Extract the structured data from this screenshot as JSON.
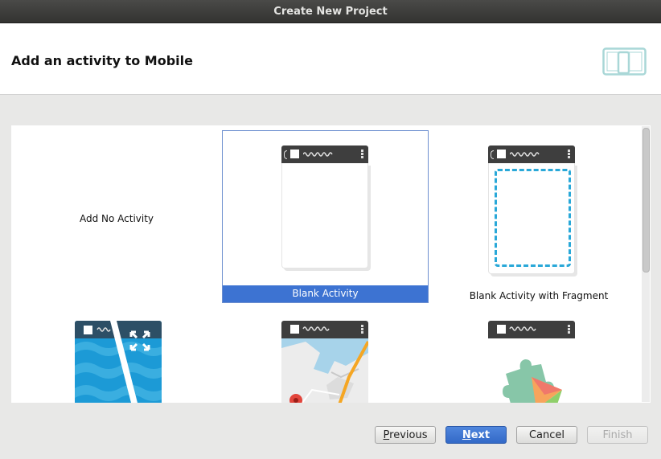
{
  "window": {
    "title": "Create New Project"
  },
  "header": {
    "heading": "Add an activity to Mobile",
    "device_icon": "phone-tablet-icon"
  },
  "gallery": {
    "items": [
      {
        "label": "Add No Activity",
        "preview": "none",
        "selected": false
      },
      {
        "label": "Blank Activity",
        "preview": "blank-phone",
        "selected": true
      },
      {
        "label": "Blank Activity with Fragment",
        "preview": "fragment-phone",
        "selected": false
      },
      {
        "label": "",
        "preview": "fullscreen-phone",
        "selected": false
      },
      {
        "label": "",
        "preview": "map-phone",
        "selected": false
      },
      {
        "label": "",
        "preview": "play-services-phone",
        "selected": false
      }
    ]
  },
  "buttons": {
    "previous": {
      "mnemonic": "P",
      "rest": "revious"
    },
    "next": {
      "mnemonic": "N",
      "rest": "ext"
    },
    "cancel": {
      "label": "Cancel"
    },
    "finish": {
      "label": "Finish"
    }
  },
  "colors": {
    "selection": "#3d73d2",
    "accent_dash": "#29a8d8",
    "titlebar": "#3c3c3a"
  }
}
